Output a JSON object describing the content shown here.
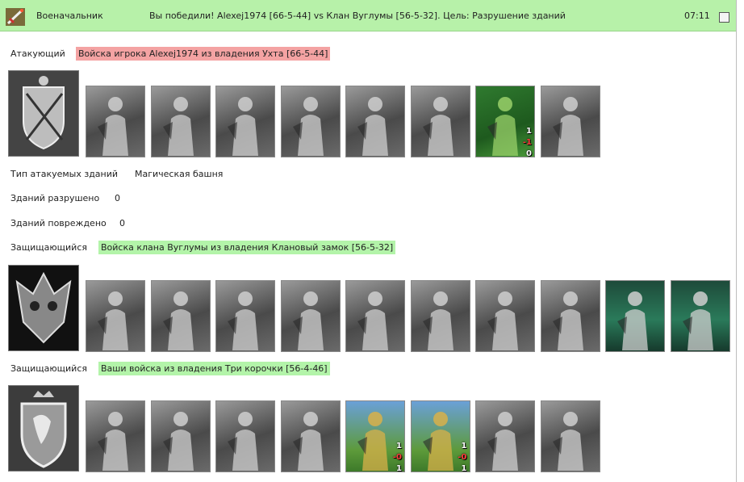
{
  "header": {
    "app_title": "Военачальник",
    "result": "Вы победили! Alexej1974 [66-5-44] vs Клан Вуглумы [56-5-32]. Цель: Разрушение зданий",
    "time": "07:11"
  },
  "attacker": {
    "label": "Атакующий",
    "force": "Войска игрока Alexej1974 из владения Ухта [66-5-44]",
    "units": [
      {
        "name": "dwarf"
      },
      {
        "name": "dark-warrior"
      },
      {
        "name": "centurion"
      },
      {
        "name": "griffin"
      },
      {
        "name": "archer"
      },
      {
        "name": "mage"
      },
      {
        "name": "green-druid",
        "counts": [
          "1",
          "-1",
          "0"
        ]
      },
      {
        "name": "sorcerer"
      }
    ]
  },
  "stats": {
    "target_type_label": "Тип атакуемых зданий",
    "target_type_value": "Магическая башня",
    "destroyed_label": "Зданий разрушено",
    "destroyed_value": "0",
    "damaged_label": "Зданий повреждено",
    "damaged_value": "0"
  },
  "defender_clan": {
    "label": "Защищающийся",
    "force": "Войска клана Вуглумы из владения Клановый замок [56-5-32]",
    "units": [
      {
        "name": "dragon"
      },
      {
        "name": "golem"
      },
      {
        "name": "minotaur"
      },
      {
        "name": "gargoyle"
      },
      {
        "name": "spider"
      },
      {
        "name": "wraith"
      },
      {
        "name": "demon-wings"
      },
      {
        "name": "lizard"
      },
      {
        "name": "candles-1"
      },
      {
        "name": "candles-2"
      }
    ]
  },
  "defender_self": {
    "label": "Защищающийся",
    "force": "Ваши войска из владения Три корочки [56-4-46]",
    "units": [
      {
        "name": "knights-pair"
      },
      {
        "name": "armored-knight"
      },
      {
        "name": "lancer"
      },
      {
        "name": "pegasus"
      },
      {
        "name": "crossbowman",
        "counts": [
          "1",
          "-0",
          "1"
        ]
      },
      {
        "name": "yellow-mage",
        "counts": [
          "1",
          "-0",
          "1"
        ]
      },
      {
        "name": "barbarian"
      },
      {
        "name": "hooded-figure"
      }
    ]
  },
  "colors": {
    "titlebar": "#b7f1a9",
    "attacker_tag": "#f4a3a3",
    "defender_tag": "#b3f4a9"
  }
}
